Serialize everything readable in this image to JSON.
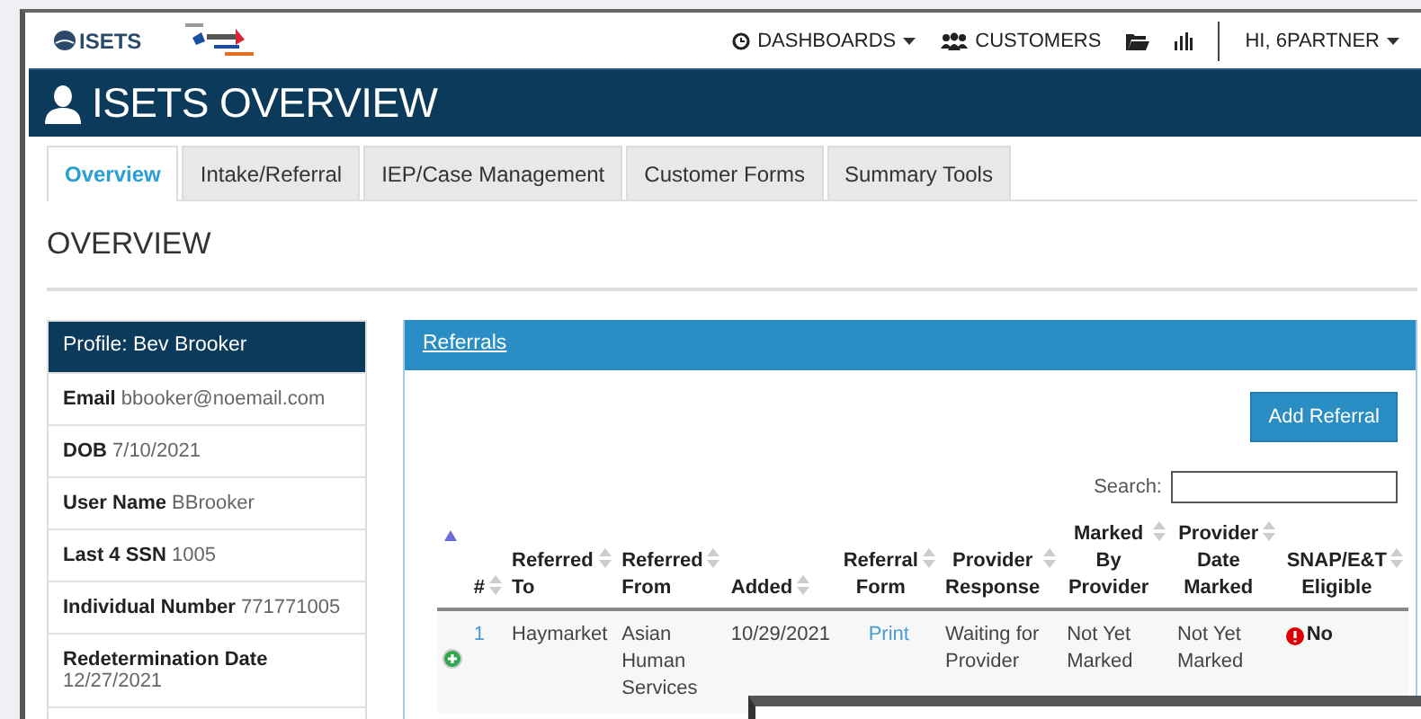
{
  "header": {
    "logo_text": "ISETS",
    "nav": [
      {
        "label": "DASHBOARDS",
        "dropdown": true
      },
      {
        "label": "CUSTOMERS",
        "dropdown": false
      }
    ],
    "user_menu": {
      "label": "HI, 6PARTNER",
      "dropdown": true
    }
  },
  "banner": {
    "title": "ISETS OVERVIEW"
  },
  "tabs": [
    {
      "label": "Overview",
      "selected": true
    },
    {
      "label": "Intake/Referral",
      "selected": false
    },
    {
      "label": "IEP/Case Management",
      "selected": false
    },
    {
      "label": "Customer Forms",
      "selected": false
    },
    {
      "label": "Summary Tools",
      "selected": false
    }
  ],
  "section_title": "OVERVIEW",
  "profile": {
    "title": "Profile: Bev Brooker",
    "fields": [
      {
        "label": "Email",
        "value": "bbooker@noemail.com"
      },
      {
        "label": "DOB",
        "value": "7/10/2021"
      },
      {
        "label": "User Name",
        "value": "BBrooker"
      },
      {
        "label": "Last 4 SSN",
        "value": "1005"
      },
      {
        "label": "Individual Number",
        "value": "771771005"
      },
      {
        "label": "Redetermination Date",
        "value": "12/27/2021"
      }
    ]
  },
  "referrals": {
    "title": "Referrals",
    "add_button": "Add Referral",
    "search_label": "Search:",
    "columns": [
      {
        "kind": "control",
        "sorted": true
      },
      {
        "kind": "text",
        "label": "#",
        "sorted": false
      },
      {
        "kind": "text",
        "label": "Referred To",
        "sorted": false
      },
      {
        "kind": "text",
        "label": "Referred From",
        "sorted": false
      },
      {
        "kind": "text",
        "label": "Added",
        "sorted": false
      },
      {
        "kind": "link",
        "label": "Referral Form",
        "sorted": false
      },
      {
        "kind": "text",
        "label": "Provider Response",
        "sorted": false
      },
      {
        "kind": "text",
        "label": "Marked By Provider",
        "sorted": false
      },
      {
        "kind": "text",
        "label": "Provider Date Marked",
        "sorted": false
      },
      {
        "kind": "flag",
        "label": "SNAP/E&T Eligible",
        "sorted": false
      }
    ],
    "rows": [
      {
        "cells": [
          "",
          "1",
          "Haymarket",
          "Asian Human Services",
          "10/29/2021",
          "Print",
          "Waiting for Provider",
          "Not Yet Marked",
          "Not Yet Marked",
          "No"
        ]
      }
    ]
  }
}
